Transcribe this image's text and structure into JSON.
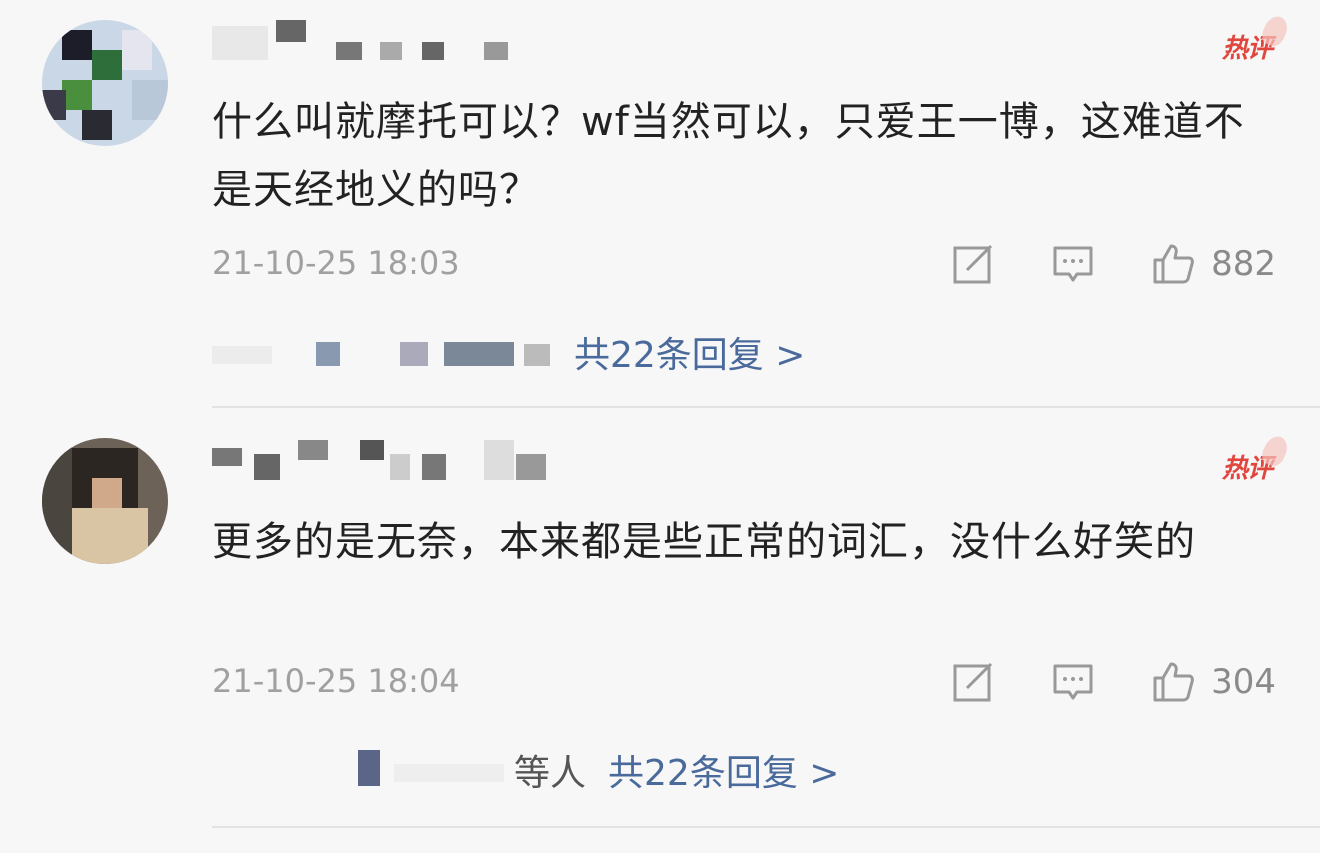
{
  "comments": [
    {
      "text": "什么叫就摩托可以？wf当然可以，只爱王一博，这难道不是天经地义的吗？",
      "time": "21-10-25 18:03",
      "badge": "热评",
      "likes": "882",
      "replies_link": "共22条回复 >",
      "replies_prefix": ""
    },
    {
      "text": "更多的是无奈，本来都是些正常的词汇，没什么好笑的",
      "time": "21-10-25 18:04",
      "badge": "热评",
      "likes": "304",
      "replies_link": "共22条回复 >",
      "replies_prefix": "等人"
    }
  ],
  "icons": {
    "repost": "edit-square-icon",
    "comment": "comment-bubble-icon",
    "like": "thumbs-up-icon"
  },
  "colors": {
    "badge": "#e0463d",
    "link": "#4a6a9c",
    "meta": "#a0a0a0"
  }
}
